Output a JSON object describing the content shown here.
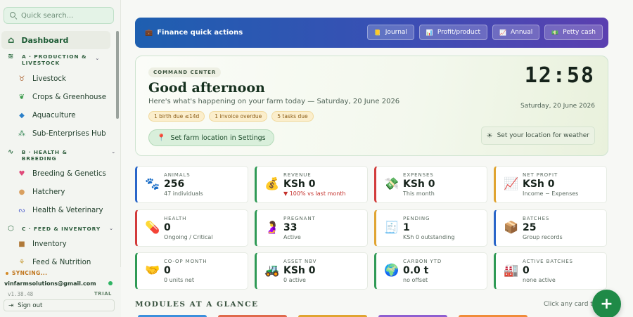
{
  "sidebar": {
    "search_placeholder": "Quick search...",
    "dashboard": "Dashboard",
    "sections": [
      {
        "label_line1": "A · PRODUCTION &",
        "label_line2": "LIVESTOCK",
        "icon": "layers-icon",
        "items": [
          {
            "label": "Livestock",
            "icon": "cow-icon"
          },
          {
            "label": "Crops & Greenhouse",
            "icon": "plant-icon"
          },
          {
            "label": "Aquaculture",
            "icon": "fish-icon"
          },
          {
            "label": "Sub-Enterprises Hub",
            "icon": "hub-icon"
          }
        ]
      },
      {
        "label_line1": "B · HEALTH & BREEDING",
        "label_line2": "",
        "icon": "pulse-icon",
        "items": [
          {
            "label": "Breeding & Genetics",
            "icon": "hearts-icon"
          },
          {
            "label": "Hatchery",
            "icon": "egg-icon"
          },
          {
            "label": "Health & Veterinary",
            "icon": "stethoscope-icon"
          }
        ]
      },
      {
        "label_line1": "C · FEED & INVENTORY",
        "label_line2": "",
        "icon": "box-icon",
        "items": [
          {
            "label": "Inventory",
            "icon": "package-icon"
          },
          {
            "label": "Feed & Nutrition",
            "icon": "wheat-icon"
          }
        ]
      }
    ],
    "sync_status": "SYNCING...",
    "email": "vinfarmsolutions@gmail.com",
    "version": "v1.38.48",
    "plan": "TRIAL",
    "signout": "Sign out"
  },
  "finance": {
    "title": "Finance quick actions",
    "buttons": [
      {
        "label": "Journal",
        "icon": "notebook-icon"
      },
      {
        "label": "Profit/product",
        "icon": "bar-chart-icon"
      },
      {
        "label": "Annual",
        "icon": "trend-chart-icon"
      },
      {
        "label": "Petty cash",
        "icon": "cash-icon"
      }
    ]
  },
  "command": {
    "tag": "COMMAND CENTER",
    "greeting": "Good afternoon",
    "subtitle": "Here's what's happening on your farm today — Saturday, 20 June 2026",
    "chips": [
      "1 birth due ≤14d",
      "1 invoice overdue",
      "5 tasks due"
    ],
    "location_button": "Set farm location in Settings",
    "clock": "12:58",
    "date": "Saturday, 20 June 2026",
    "weather_button": "Set your location for weather"
  },
  "stats": [
    {
      "label": "ANIMALS",
      "value": "256",
      "note": "47 individuals",
      "icon": "paw-icon",
      "color": "#2a66c9",
      "negative": false
    },
    {
      "label": "REVENUE",
      "value": "KSh 0",
      "note": "▼ 100% vs last month",
      "icon": "money-bag-icon",
      "color": "#2f9a55",
      "negative": true
    },
    {
      "label": "EXPENSES",
      "value": "KSh 0",
      "note": "This month",
      "icon": "banknotes-icon",
      "color": "#d23b3b",
      "negative": false
    },
    {
      "label": "NET PROFIT",
      "value": "KSh 0",
      "note": "Income − Expenses",
      "icon": "chart-up-icon",
      "color": "#e0a431",
      "negative": false
    },
    {
      "label": "HEALTH",
      "value": "0",
      "note": "Ongoing / Critical",
      "icon": "pill-icon",
      "color": "#d23b3b",
      "negative": false
    },
    {
      "label": "PREGNANT",
      "value": "33",
      "note": "Active",
      "icon": "pregnant-icon",
      "color": "#2f9a55",
      "negative": false
    },
    {
      "label": "PENDING",
      "value": "1",
      "note": "KSh 0 outstanding",
      "icon": "receipt-icon",
      "color": "#e0a431",
      "negative": false
    },
    {
      "label": "BATCHES",
      "value": "25",
      "note": "Group records",
      "icon": "package-icon",
      "color": "#2a66c9",
      "negative": false
    },
    {
      "label": "CO-OP MONTH",
      "value": "0",
      "note": "0 units net",
      "icon": "handshake-icon",
      "color": "#2f9a55",
      "negative": false
    },
    {
      "label": "ASSET NBV",
      "value": "KSh 0",
      "note": "0 active",
      "icon": "tractor-icon",
      "color": "#2f9a55",
      "negative": false
    },
    {
      "label": "CARBON YTD",
      "value": "0.0 t",
      "note": "no offset",
      "icon": "globe-icon",
      "color": "#2f9a55",
      "negative": false
    },
    {
      "label": "ACTIVE BATCHES",
      "value": "0",
      "note": "none active",
      "icon": "factory-icon",
      "color": "#2f9a55",
      "negative": false
    }
  ],
  "modules": {
    "title": "MODULES AT A GLANCE",
    "hint": "Click any card to",
    "strip_colors": [
      "#3b8fdc",
      "#e06a4c",
      "#e0a431",
      "#8e5fd0",
      "#f08c3a",
      "#3aa86a"
    ]
  },
  "fab_label": "+"
}
